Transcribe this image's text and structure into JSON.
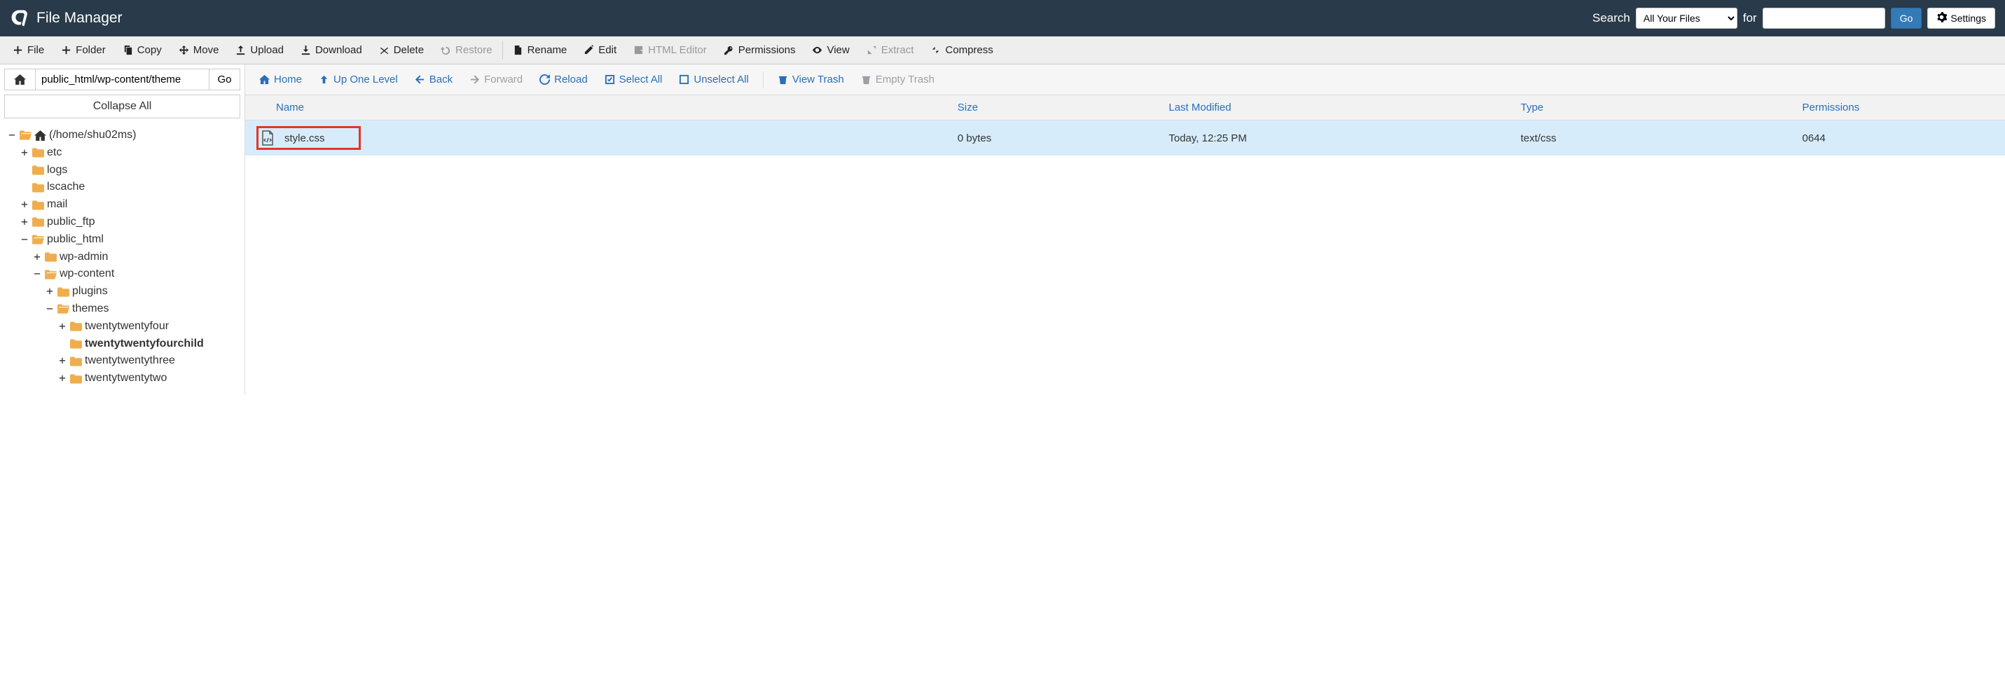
{
  "header": {
    "app_title": "File Manager",
    "search_label": "Search",
    "search_select": "All Your Files",
    "for_label": "for",
    "go_label": "Go",
    "settings_label": "Settings"
  },
  "toolbar": {
    "file": "File",
    "folder": "Folder",
    "copy": "Copy",
    "move": "Move",
    "upload": "Upload",
    "download": "Download",
    "delete": "Delete",
    "restore": "Restore",
    "rename": "Rename",
    "edit": "Edit",
    "html_editor": "HTML Editor",
    "permissions": "Permissions",
    "view": "View",
    "extract": "Extract",
    "compress": "Compress"
  },
  "path": {
    "value": "public_html/wp-content/theme",
    "go": "Go"
  },
  "collapse_all": "Collapse All",
  "tree": {
    "root": "(/home/shu02ms)",
    "etc": "etc",
    "logs": "logs",
    "lscache": "lscache",
    "mail": "mail",
    "public_ftp": "public_ftp",
    "public_html": "public_html",
    "wp_admin": "wp-admin",
    "wp_content": "wp-content",
    "plugins": "plugins",
    "themes": "themes",
    "tt4": "twentytwentyfour",
    "tt4child": "twentytwentyfourchild",
    "tt3": "twentytwentythree",
    "tt2": "twentytwentytwo"
  },
  "sec": {
    "home": "Home",
    "up": "Up One Level",
    "back": "Back",
    "forward": "Forward",
    "reload": "Reload",
    "select_all": "Select All",
    "unselect_all": "Unselect All",
    "view_trash": "View Trash",
    "empty_trash": "Empty Trash"
  },
  "table": {
    "headers": {
      "name": "Name",
      "size": "Size",
      "modified": "Last Modified",
      "type": "Type",
      "permissions": "Permissions"
    },
    "rows": [
      {
        "name": "style.css",
        "size": "0 bytes",
        "modified": "Today, 12:25 PM",
        "type": "text/css",
        "permissions": "0644"
      }
    ]
  }
}
